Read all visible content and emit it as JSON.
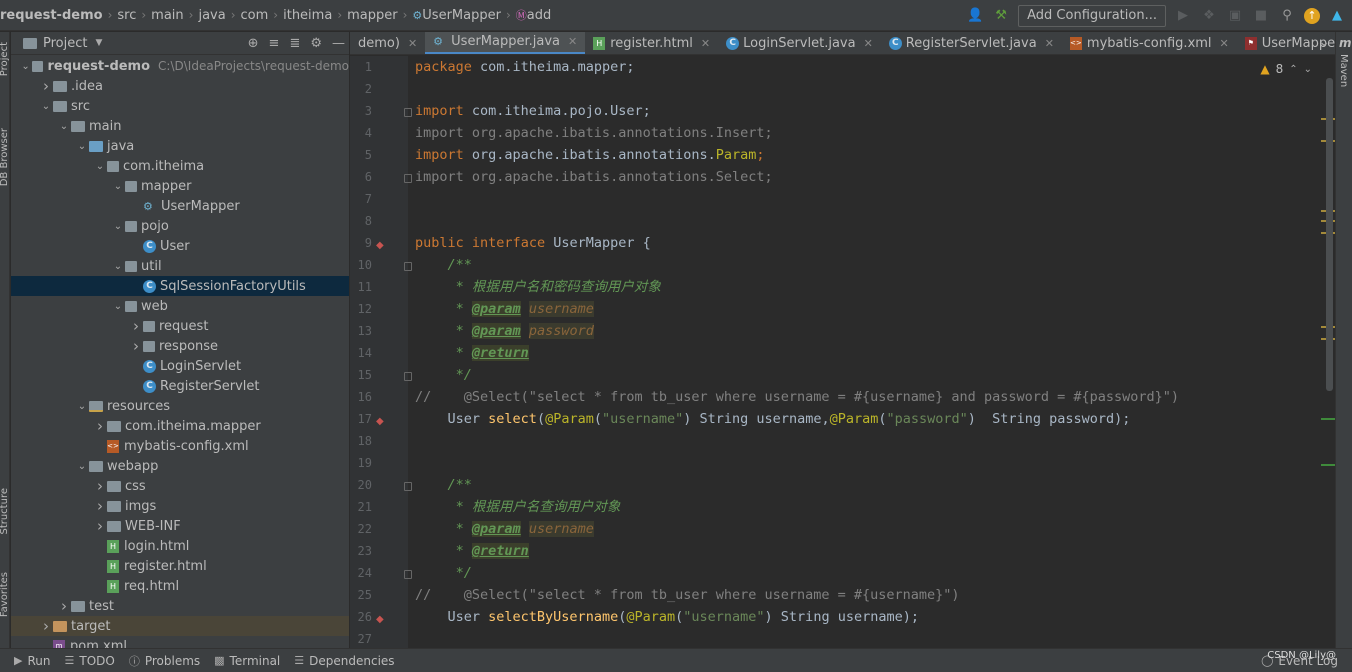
{
  "breadcrumb": [
    "request-demo",
    "src",
    "main",
    "java",
    "com",
    "itheima",
    "mapper",
    "UserMapper",
    "add"
  ],
  "toolbar": {
    "config_label": "Add Configuration..."
  },
  "left_bar": {
    "project": "Project",
    "db_browser": "DB Browser",
    "structure": "Structure",
    "favorites": "Favorites"
  },
  "project_panel": {
    "title": "Project",
    "tree": [
      {
        "label": "request-demo",
        "hint": "C:\\D\\IdeaProjects\\request-demo",
        "depth": 0,
        "arrow": "down",
        "icon": "module-folder"
      },
      {
        "label": ".idea",
        "depth": 1,
        "arrow": "right",
        "icon": "folder"
      },
      {
        "label": "src",
        "depth": 1,
        "arrow": "down",
        "icon": "folder"
      },
      {
        "label": "main",
        "depth": 2,
        "arrow": "down",
        "icon": "folder"
      },
      {
        "label": "java",
        "depth": 3,
        "arrow": "down",
        "icon": "source-folder"
      },
      {
        "label": "com.itheima",
        "depth": 4,
        "arrow": "down",
        "icon": "package"
      },
      {
        "label": "mapper",
        "depth": 5,
        "arrow": "down",
        "icon": "package"
      },
      {
        "label": "UserMapper",
        "depth": 6,
        "arrow": "",
        "icon": "interface"
      },
      {
        "label": "pojo",
        "depth": 5,
        "arrow": "down",
        "icon": "package"
      },
      {
        "label": "User",
        "depth": 6,
        "arrow": "",
        "icon": "class"
      },
      {
        "label": "util",
        "depth": 5,
        "arrow": "down",
        "icon": "package"
      },
      {
        "label": "SqlSessionFactoryUtils",
        "depth": 6,
        "arrow": "",
        "icon": "class",
        "selected": true
      },
      {
        "label": "web",
        "depth": 5,
        "arrow": "down",
        "icon": "package"
      },
      {
        "label": "request",
        "depth": 6,
        "arrow": "right",
        "icon": "package"
      },
      {
        "label": "response",
        "depth": 6,
        "arrow": "right",
        "icon": "package"
      },
      {
        "label": "LoginServlet",
        "depth": 6,
        "arrow": "",
        "icon": "class"
      },
      {
        "label": "RegisterServlet",
        "depth": 6,
        "arrow": "",
        "icon": "class"
      },
      {
        "label": "resources",
        "depth": 3,
        "arrow": "down",
        "icon": "resources-folder"
      },
      {
        "label": "com.itheima.mapper",
        "depth": 4,
        "arrow": "right",
        "icon": "folder"
      },
      {
        "label": "mybatis-config.xml",
        "depth": 4,
        "arrow": "",
        "icon": "xml"
      },
      {
        "label": "webapp",
        "depth": 3,
        "arrow": "down",
        "icon": "folder"
      },
      {
        "label": "css",
        "depth": 4,
        "arrow": "right",
        "icon": "folder"
      },
      {
        "label": "imgs",
        "depth": 4,
        "arrow": "right",
        "icon": "folder"
      },
      {
        "label": "WEB-INF",
        "depth": 4,
        "arrow": "right",
        "icon": "folder"
      },
      {
        "label": "login.html",
        "depth": 4,
        "arrow": "",
        "icon": "html"
      },
      {
        "label": "register.html",
        "depth": 4,
        "arrow": "",
        "icon": "html"
      },
      {
        "label": "req.html",
        "depth": 4,
        "arrow": "",
        "icon": "html"
      },
      {
        "label": "test",
        "depth": 2,
        "arrow": "right",
        "icon": "folder"
      },
      {
        "label": "target",
        "depth": 1,
        "arrow": "right",
        "icon": "excluded-folder",
        "target": true
      },
      {
        "label": "pom.xml",
        "depth": 1,
        "arrow": "",
        "icon": "maven"
      }
    ]
  },
  "tabs": [
    {
      "label": "demo)",
      "icon": "",
      "active": false,
      "close": true
    },
    {
      "label": "UserMapper.java",
      "icon": "interface",
      "active": true,
      "close": true
    },
    {
      "label": "register.html",
      "icon": "html",
      "active": false,
      "close": true
    },
    {
      "label": "LoginServlet.java",
      "icon": "class",
      "active": false,
      "close": true
    },
    {
      "label": "RegisterServlet.java",
      "icon": "class",
      "active": false,
      "close": true
    },
    {
      "label": "mybatis-config.xml",
      "icon": "xml",
      "active": false,
      "close": true
    },
    {
      "label": "UserMapper.xml",
      "icon": "mapper-xml",
      "active": false,
      "close": false
    }
  ],
  "editor": {
    "warning_count": "8",
    "line_numbers": [
      "1",
      "2",
      "3",
      "4",
      "5",
      "6",
      "7",
      "8",
      "9",
      "10",
      "11",
      "12",
      "13",
      "14",
      "15",
      "16",
      "17",
      "18",
      "19",
      "20",
      "21",
      "22",
      "23",
      "24",
      "25",
      "26",
      "27"
    ]
  },
  "code": {
    "l1_kw": "package",
    "l1_rest": " com.itheima.mapper;",
    "l3_kw": "import",
    "l3_rest": " com.itheima.pojo.User;",
    "l4": "import org.apache.ibatis.annotations.Insert;",
    "l5_kw": "import",
    "l5_rest": " org.apache.ibatis.annotations.",
    "l5_cls": "Param",
    "l5_semi": ";",
    "l6": "import org.apache.ibatis.annotations.Select;",
    "l9_kw1": "public",
    "l9_kw2": "interface",
    "l9_name": " UserMapper {",
    "l10": "    /**",
    "l11": "     * 根据用户名和密码查询用户对象",
    "l12_pre": "     * ",
    "l12_tag": "@param",
    "l12_param": "username",
    "l13_pre": "     * ",
    "l13_tag": "@param",
    "l13_param": "password",
    "l14_pre": "     * ",
    "l14_tag": "@return",
    "l15": "     */",
    "l16": "//    @Select(\"select * from tb_user where username = #{username} and password = #{password}\")",
    "l17_a": "    User ",
    "l17_fn": "select",
    "l17_b": "(",
    "l17_an1": "@Param",
    "l17_c": "(",
    "l17_s1": "\"username\"",
    "l17_d": ") String username,",
    "l17_an2": "@Param",
    "l17_e": "(",
    "l17_s2": "\"password\"",
    "l17_f": ")  String password);",
    "l20": "    /**",
    "l21": "     * 根据用户名查询用户对象",
    "l22_pre": "     * ",
    "l22_tag": "@param",
    "l22_param": "username",
    "l23_pre": "     * ",
    "l23_tag": "@return",
    "l24": "     */",
    "l25": "//    @Select(\"select * from tb_user where username = #{username}\")",
    "l26_a": "    User ",
    "l26_fn": "selectByUsername",
    "l26_b": "(",
    "l26_an": "@Param",
    "l26_c": "(",
    "l26_s": "\"username\"",
    "l26_d": ") String username);"
  },
  "right_bar": {
    "maven": "Maven"
  },
  "statusbar": {
    "run": "Run",
    "todo": "TODO",
    "problems": "Problems",
    "terminal": "Terminal",
    "dependencies": "Dependencies",
    "event_log": "Event Log",
    "watermark": "CSDN @Lily@"
  }
}
